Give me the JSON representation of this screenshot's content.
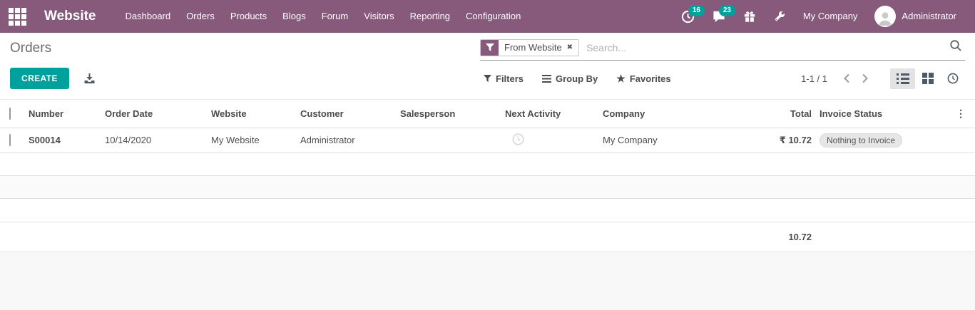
{
  "navbar": {
    "brand": "Website",
    "menu_items": [
      "Dashboard",
      "Orders",
      "Products",
      "Blogs",
      "Forum",
      "Visitors",
      "Reporting",
      "Configuration"
    ],
    "activity_badge": "16",
    "message_badge": "23",
    "company_name": "My Company",
    "user_name": "Administrator"
  },
  "breadcrumb": {
    "title": "Orders"
  },
  "search": {
    "facet_label": "From Website",
    "facet_remove_glyph": "✖",
    "placeholder": "Search..."
  },
  "control_panel": {
    "create_label": "CREATE",
    "filters_label": "Filters",
    "group_by_label": "Group By",
    "favorites_label": "Favorites",
    "favorites_star_glyph": "★",
    "pager_value": "1-1 / 1",
    "more_columns_glyph": "⋮"
  },
  "table": {
    "headers": [
      "Number",
      "Order Date",
      "Website",
      "Customer",
      "Salesperson",
      "Next Activity",
      "Company",
      "Total",
      "Invoice Status"
    ],
    "row": {
      "number": "S00014",
      "order_date": "10/14/2020",
      "website": "My Website",
      "customer": "Administrator",
      "salesperson": "",
      "company": "My Company",
      "total": "₹ 10.72",
      "invoice_status": "Nothing to Invoice"
    },
    "footer_total": "10.72"
  },
  "colors": {
    "navbar_bg": "#875A7B",
    "accent_teal": "#00A09D",
    "badge_bg": "#00A09D"
  }
}
